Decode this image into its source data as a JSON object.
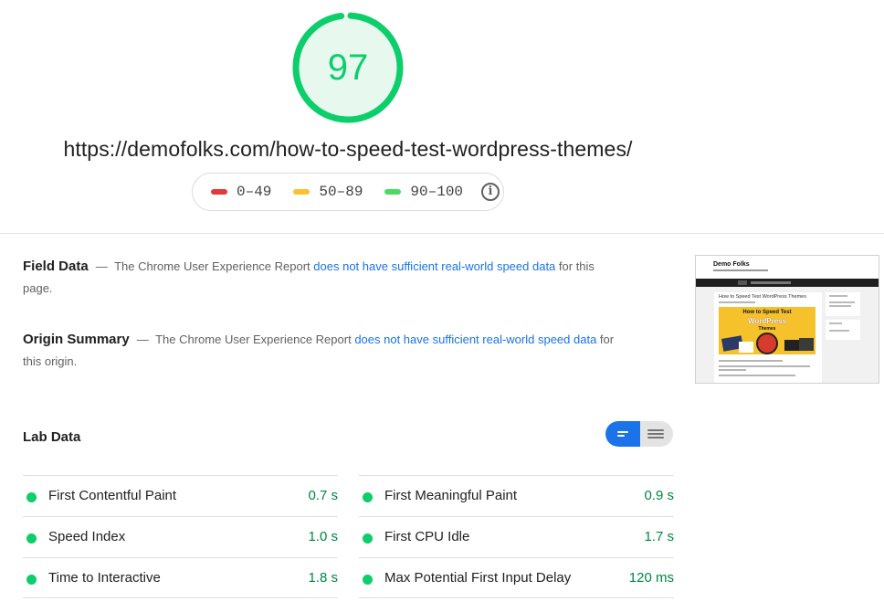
{
  "report": {
    "score": "97",
    "score_fraction": 0.97,
    "url": "https://demofolks.com/how-to-speed-test-wordpress-themes/"
  },
  "legend": {
    "items": [
      {
        "label": "0–49",
        "color": "#e53935"
      },
      {
        "label": "50–89",
        "color": "#fbc02d"
      },
      {
        "label": "90–100",
        "color": "#4cd964"
      }
    ],
    "info_icon": "info-icon"
  },
  "field_data": {
    "heading": "Field Data",
    "dash": "—",
    "text_before": "The Chrome User Experience Report",
    "link": "does not have sufficient real-world speed data",
    "text_after": "for this page."
  },
  "origin_summary": {
    "heading": "Origin Summary",
    "dash": "—",
    "text_before": "The Chrome User Experience Report",
    "link": "does not have sufficient real-world speed data",
    "text_after": "for this origin."
  },
  "thumbnail": {
    "site_title": "Demo Folks",
    "post_title": "How to Speed Test WordPress Themes",
    "hero_line1": "How to Speed Test",
    "hero_line2": "WordPress",
    "hero_line3": "Themes"
  },
  "lab_data": {
    "title": "Lab Data",
    "view_toggle": {
      "selected": "bar-view",
      "options": [
        "bar-view",
        "list-view"
      ]
    },
    "metrics_left": [
      {
        "name": "First Contentful Paint",
        "value": "0.7 s",
        "status": "pass"
      },
      {
        "name": "Speed Index",
        "value": "1.0 s",
        "status": "pass"
      },
      {
        "name": "Time to Interactive",
        "value": "1.8 s",
        "status": "pass"
      }
    ],
    "metrics_right": [
      {
        "name": "First Meaningful Paint",
        "value": "0.9 s",
        "status": "pass"
      },
      {
        "name": "First CPU Idle",
        "value": "1.7 s",
        "status": "pass"
      },
      {
        "name": "Max Potential First Input Delay",
        "value": "120 ms",
        "status": "pass"
      }
    ]
  },
  "colors": {
    "pass": "#0cce6b",
    "pass_text": "#018642",
    "link": "#1a73e8",
    "gauge_bg": "#e7f9ee"
  }
}
